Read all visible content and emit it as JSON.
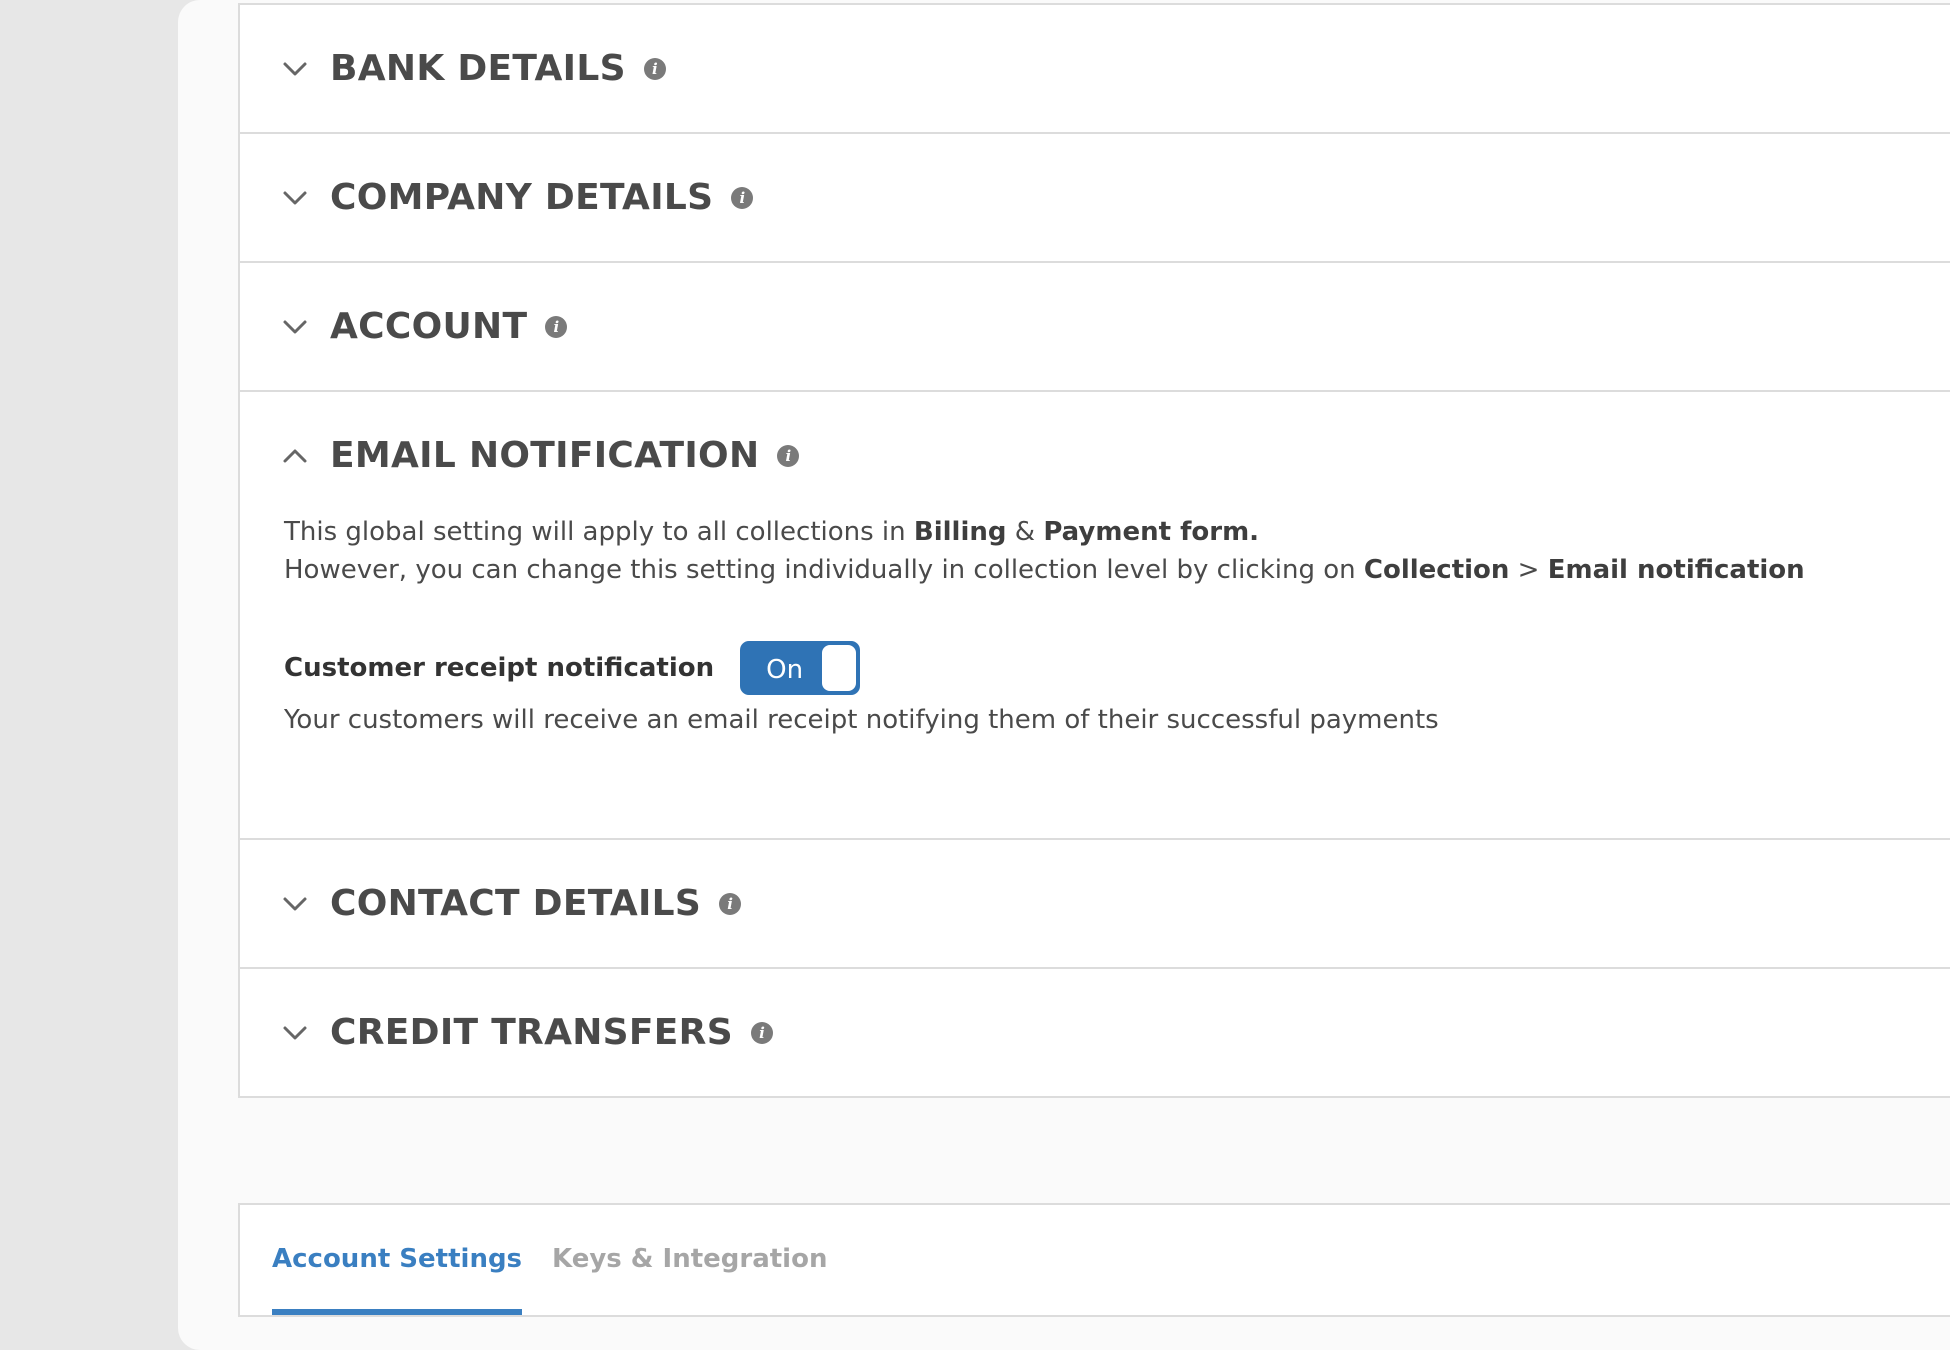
{
  "sections": [
    {
      "title": "BANK DETAILS",
      "expanded": false
    },
    {
      "title": "COMPANY DETAILS",
      "expanded": false
    },
    {
      "title": "ACCOUNT",
      "expanded": false
    },
    {
      "title": "EMAIL NOTIFICATION",
      "expanded": true
    },
    {
      "title": "CONTACT DETAILS",
      "expanded": false
    },
    {
      "title": "CREDIT TRANSFERS",
      "expanded": false
    }
  ],
  "email_notification": {
    "line1_prefix": "This global setting will apply to all collections in ",
    "line1_bold1": "Billing",
    "line1_amp": " & ",
    "line1_bold2": "Payment form.",
    "line2_prefix": "However, you can change this setting individually in collection level by clicking on ",
    "line2_bold1": "Collection",
    "line2_sep": " > ",
    "line2_bold2": "Email notification",
    "option_label": "Customer receipt notification",
    "toggle_state": "On",
    "help_text": "Your customers will receive an email receipt notifying them of their successful payments"
  },
  "tabs": [
    {
      "label": "Account Settings",
      "active": true
    },
    {
      "label": "Keys & Integration",
      "active": false
    }
  ],
  "icons": {
    "chevron_collapsed": "chevron-down-icon",
    "chevron_expanded": "chevron-up-icon",
    "info": "info-icon"
  },
  "colors": {
    "accent": "#3a7fc1",
    "toggle_on": "#2f73b5",
    "heading": "#4a4a4a"
  }
}
